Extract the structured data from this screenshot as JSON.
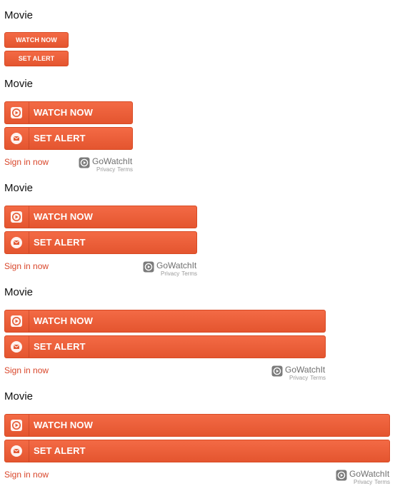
{
  "colors": {
    "button_gradient_top": "#f36a45",
    "button_gradient_bottom": "#e4552f",
    "button_border": "#d84a24",
    "signin_link": "#d9462a",
    "brand_text": "#6f6f6f",
    "legal_text": "#9a9a9a"
  },
  "widgets": [
    {
      "title": "Movie",
      "watch_label": "WATCH NOW",
      "alert_label": "SET ALERT"
    },
    {
      "title": "Movie",
      "watch_label": "WATCH NOW",
      "alert_label": "SET ALERT",
      "watch_icon": "play-icon",
      "alert_icon": "envelope-icon",
      "signin_label": "Sign in now",
      "brand": "GoWatchIt",
      "brand_icon": "play-logo-icon",
      "privacy_label": "Privacy",
      "terms_label": "Terms"
    },
    {
      "title": "Movie",
      "watch_label": "WATCH NOW",
      "alert_label": "SET ALERT",
      "watch_icon": "play-icon",
      "alert_icon": "envelope-icon",
      "signin_label": "Sign in now",
      "brand": "GoWatchIt",
      "brand_icon": "play-logo-icon",
      "privacy_label": "Privacy",
      "terms_label": "Terms"
    },
    {
      "title": "Movie",
      "watch_label": "WATCH NOW",
      "alert_label": "SET ALERT",
      "watch_icon": "play-icon",
      "alert_icon": "envelope-icon",
      "signin_label": "Sign in now",
      "brand": "GoWatchIt",
      "brand_icon": "play-logo-icon",
      "privacy_label": "Privacy",
      "terms_label": "Terms"
    },
    {
      "title": "Movie",
      "watch_label": "WATCH NOW",
      "alert_label": "SET ALERT",
      "watch_icon": "play-icon",
      "alert_icon": "envelope-icon",
      "signin_label": "Sign in now",
      "brand": "GoWatchIt",
      "brand_icon": "play-logo-icon",
      "privacy_label": "Privacy",
      "terms_label": "Terms"
    }
  ]
}
